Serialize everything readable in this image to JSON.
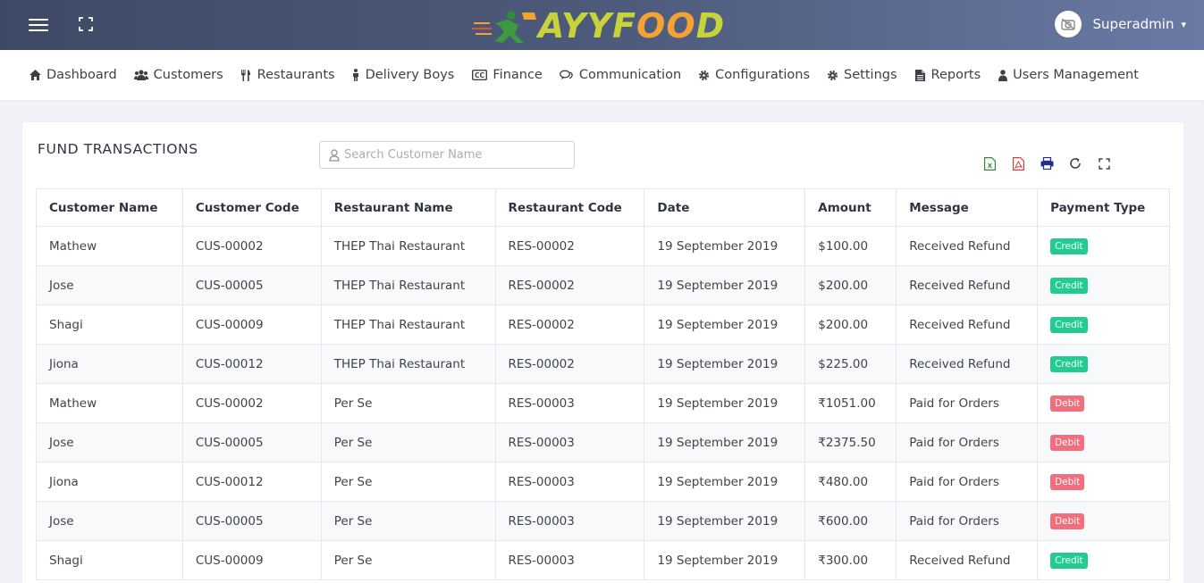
{
  "header": {
    "logo_text_1": "AYYF",
    "logo_text_o": "OO",
    "logo_text_2": "D",
    "user_name": "Superadmin"
  },
  "nav": {
    "items": [
      {
        "label": "Dashboard",
        "icon": "home-icon"
      },
      {
        "label": "Customers",
        "icon": "users-icon"
      },
      {
        "label": "Restaurants",
        "icon": "cutlery-icon"
      },
      {
        "label": "Delivery Boys",
        "icon": "person-icon"
      },
      {
        "label": "Finance",
        "icon": "cc-icon"
      },
      {
        "label": "Communication",
        "icon": "chat-icon"
      },
      {
        "label": "Configurations",
        "icon": "gear-icon"
      },
      {
        "label": "Settings",
        "icon": "gear-icon"
      },
      {
        "label": "Reports",
        "icon": "file-icon"
      },
      {
        "label": "Users Management",
        "icon": "user-icon"
      }
    ]
  },
  "page": {
    "title": "FUND TRANSACTIONS",
    "search_placeholder": "Search Customer Name",
    "tool_colors": {
      "excel": "#2e8b3a",
      "pdf": "#e03b3b",
      "print": "#1f2f8f",
      "refresh": "#444444",
      "fullscreen": "#444444"
    }
  },
  "table": {
    "columns": [
      "Customer Name",
      "Customer Code",
      "Restaurant Name",
      "Restaurant Code",
      "Date",
      "Amount",
      "Message",
      "Payment Type"
    ],
    "rows": [
      [
        "Mathew",
        "CUS-00002",
        "THEP Thai Restaurant",
        "RES-00002",
        "19 September 2019",
        "$100.00",
        "Received Refund",
        "Credit"
      ],
      [
        "Jose",
        "CUS-00005",
        "THEP Thai Restaurant",
        "RES-00002",
        "19 September 2019",
        "$200.00",
        "Received Refund",
        "Credit"
      ],
      [
        "Shagi",
        "CUS-00009",
        "THEP Thai Restaurant",
        "RES-00002",
        "19 September 2019",
        "$200.00",
        "Received Refund",
        "Credit"
      ],
      [
        "Jiona",
        "CUS-00012",
        "THEP Thai Restaurant",
        "RES-00002",
        "19 September 2019",
        "$225.00",
        "Received Refund",
        "Credit"
      ],
      [
        "Mathew",
        "CUS-00002",
        "Per Se",
        "RES-00003",
        "19 September 2019",
        "₹1051.00",
        "Paid for Orders",
        "Debit"
      ],
      [
        "Jose",
        "CUS-00005",
        "Per Se",
        "RES-00003",
        "19 September 2019",
        "₹2375.50",
        "Paid for Orders",
        "Debit"
      ],
      [
        "Jiona",
        "CUS-00012",
        "Per Se",
        "RES-00003",
        "19 September 2019",
        "₹480.00",
        "Paid for Orders",
        "Debit"
      ],
      [
        "Jose",
        "CUS-00005",
        "Per Se",
        "RES-00003",
        "19 September 2019",
        "₹600.00",
        "Paid for Orders",
        "Debit"
      ],
      [
        "Shagi",
        "CUS-00009",
        "Per Se",
        "RES-00003",
        "19 September 2019",
        "₹300.00",
        "Received Refund",
        "Credit"
      ]
    ]
  }
}
